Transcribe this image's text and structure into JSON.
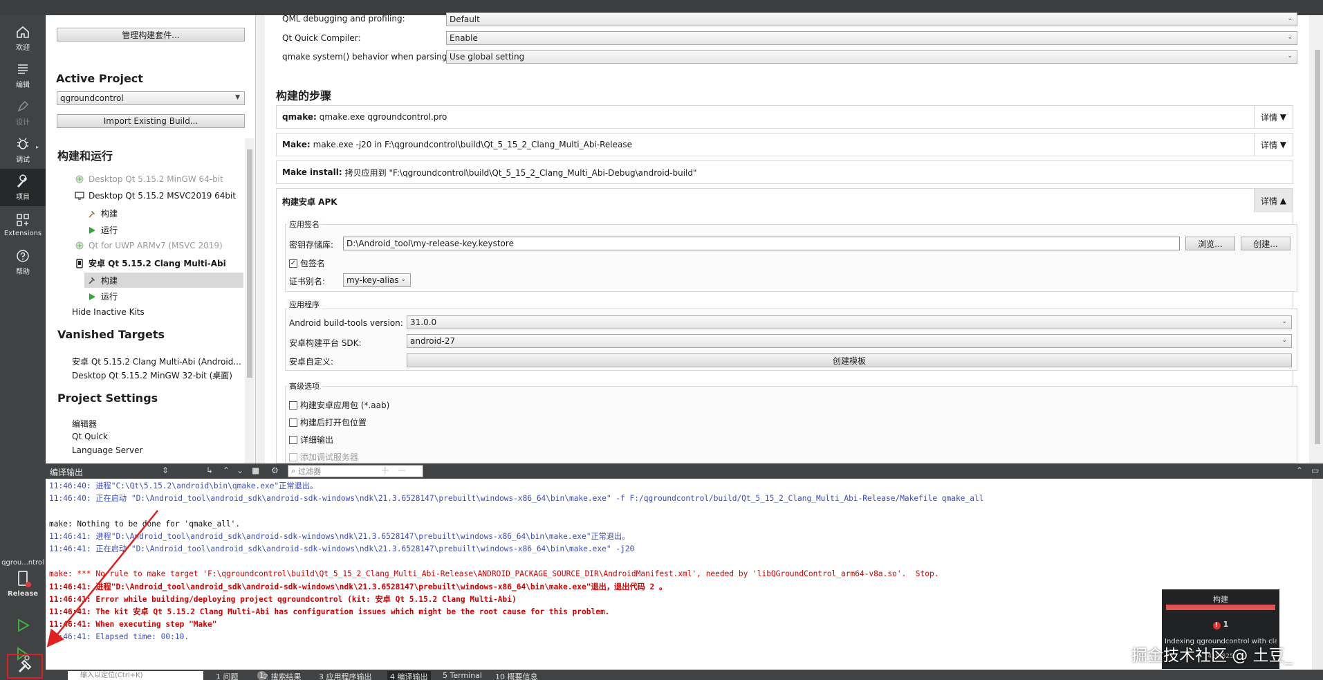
{
  "modes": {
    "welcome": "欢迎",
    "edit": "编辑",
    "design": "设计",
    "debug": "调试",
    "projects": "项目",
    "extensions": "Extensions",
    "help": "帮助"
  },
  "kit_selector": {
    "project": "qgrou...ntrol",
    "config": "Release"
  },
  "left": {
    "manage_kits": "管理构建套件...",
    "active_project_title": "Active Project",
    "active_project_value": "qgroundcontrol",
    "import_build": "Import Existing Build...",
    "build_run_title": "构建和运行",
    "kits": [
      {
        "label": "Desktop Qt 5.15.2 MinGW 64-bit"
      },
      {
        "label": "Desktop Qt 5.15.2 MSVC2019 64bit"
      },
      {
        "label": "构建"
      },
      {
        "label": "运行"
      },
      {
        "label": "Qt  for UWP ARMv7 (MSVC 2019)"
      },
      {
        "label": "安卓 Qt 5.15.2 Clang Multi-Abi"
      },
      {
        "label": "构建"
      },
      {
        "label": "运行"
      }
    ],
    "hide_inactive": "Hide Inactive Kits",
    "vanished_title": "Vanished Targets",
    "vanished": [
      "安卓 Qt 5.15.2 Clang Multi-Abi (Android...",
      "Desktop Qt 5.15.2 MinGW 32-bit (桌面)"
    ],
    "settings_title": "Project Settings",
    "settings": [
      "编辑器",
      "Qt Quick",
      "Language Server"
    ]
  },
  "main": {
    "qml_debug_label": "QML debugging and profiling:",
    "qml_debug_value": "Default",
    "qtquick_label": "Qt Quick Compiler:",
    "qtquick_value": "Enable",
    "qmake_label": "qmake system() behavior when parsing:",
    "qmake_value": "Use global setting",
    "steps_title": "构建的步骤",
    "steps": [
      {
        "name": "qmake:",
        "desc": "qmake.exe qgroundcontrol.pro",
        "details": "详情"
      },
      {
        "name": "Make:",
        "desc": "make.exe -j20 in F:\\qgroundcontrol\\build\\Qt_5_15_2_Clang_Multi_Abi-Release",
        "details": "详情"
      },
      {
        "name": "Make install:",
        "desc": "拷贝应用到 \"F:\\qgroundcontrol\\build\\Qt_5_15_2_Clang_Multi_Abi-Debug\\android-build\"",
        "details": ""
      }
    ],
    "apk": {
      "title": "构建安卓 APK",
      "details": "详情",
      "signing_group": "应用签名",
      "keystore_label": "密钥存储库:",
      "keystore_value": "D:\\Android_tool\\my-release-key.keystore",
      "browse": "浏览...",
      "create": "创建...",
      "sign_package": "包签名",
      "cert_alias_label": "证书别名:",
      "cert_alias_value": "my-key-alias",
      "app_group": "应用程序",
      "build_tools_label": "Android build-tools version:",
      "build_tools_value": "31.0.0",
      "sdk_label": "安卓构建平台 SDK:",
      "sdk_value": "android-27",
      "custom_label": "安卓自定义:",
      "create_template": "创建模板",
      "advanced_group": "高级选项",
      "adv_aab": "构建安卓应用包 (*.aab)",
      "adv_open": "构建后打开包位置",
      "adv_verbose": "详细输出",
      "adv_debug": "添加调试服务器"
    }
  },
  "output_pane": {
    "title": "编译输出",
    "filter_placeholder": "过滤器",
    "lines": [
      {
        "t": "11:46:40: 进程\"C:\\Qt\\5.15.2\\android\\bin\\qmake.exe\"正常退出。",
        "c": "c-info"
      },
      {
        "t": "11:46:40: 正在启动 \"D:\\Android_tool\\android_sdk\\android-sdk-windows\\ndk\\21.3.6528147\\prebuilt\\windows-x86_64\\bin\\make.exe\" -f F:/qgroundcontrol/build/Qt_5_15_2_Clang_Multi_Abi-Release/Makefile qmake_all",
        "c": "c-info"
      },
      {
        "t": "",
        "c": "c-blank"
      },
      {
        "t": "make: Nothing to be done for 'qmake_all'.",
        "c": "c-normal"
      },
      {
        "t": "11:46:41: 进程\"D:\\Android_tool\\android_sdk\\android-sdk-windows\\ndk\\21.3.6528147\\prebuilt\\windows-x86_64\\bin\\make.exe\"正常退出。",
        "c": "c-info"
      },
      {
        "t": "11:46:41: 正在启动 \"D:\\Android_tool\\android_sdk\\android-sdk-windows\\ndk\\21.3.6528147\\prebuilt\\windows-x86_64\\bin\\make.exe\" -j20",
        "c": "c-info"
      },
      {
        "t": "",
        "c": "c-blank"
      },
      {
        "t": "make: *** No rule to make target 'F:\\qgroundcontrol\\build\\Qt_5_15_2_Clang_Multi_Abi-Release\\ANDROID_PACKAGE_SOURCE_DIR\\AndroidManifest.xml', needed by 'libQGroundControl_arm64-v8a.so'.  Stop.",
        "c": "c-err"
      },
      {
        "t": "11:46:41: 进程\"D:\\Android_tool\\android_sdk\\android-sdk-windows\\ndk\\21.3.6528147\\prebuilt\\windows-x86_64\\bin\\make.exe\"退出，退出代码 2 。",
        "c": "c-errb"
      },
      {
        "t": "11:46:41: Error while building/deploying project qgroundcontrol (kit: 安卓 Qt 5.15.2 Clang Multi-Abi)",
        "c": "c-errb"
      },
      {
        "t": "11:46:41: The kit 安卓 Qt 5.15.2 Clang Multi-Abi has configuration issues which might be the root cause for this problem.",
        "c": "c-errb"
      },
      {
        "t": "11:46:41: When executing step \"Make\"",
        "c": "c-errb"
      },
      {
        "t": "11:46:41: Elapsed time: 00:10.",
        "c": "c-info"
      }
    ]
  },
  "status": {
    "locator_placeholder": "输入以定位(Ctrl+K)",
    "tabs": [
      "1 问题",
      "2 搜索结果",
      "3 应用程序输出",
      "4 编译输出",
      "5 Terminal",
      "10 概要信息"
    ],
    "issues_count": "1"
  },
  "progress": {
    "title": "构建",
    "fraction": 1.0,
    "errors": "1",
    "indexing": "Indexing qgroundcontrol with clangd",
    "count": "419/825"
  },
  "watermark": "掘金技术社区 @ 土豆_",
  "colors": {
    "modebar": "#404244",
    "error": "#d10000",
    "info": "#3a4cc0",
    "highlight": "#e02020"
  }
}
